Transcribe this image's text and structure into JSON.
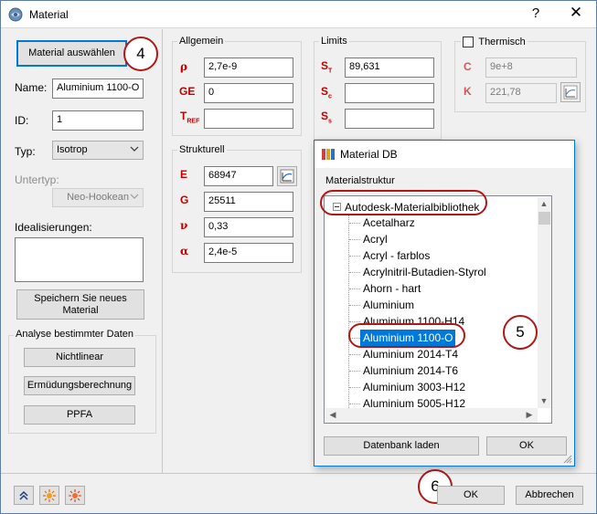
{
  "window": {
    "title": "Material",
    "help_glyph": "?",
    "close_glyph": "✕"
  },
  "left": {
    "select_material_label": "Material auswählen",
    "name_label": "Name:",
    "name_value": "Aluminium 1100-O",
    "id_label": "ID:",
    "id_value": "1",
    "type_label": "Typ:",
    "type_value": "Isotrop",
    "subtype_label": "Untertyp:",
    "subtype_value": "Neo-Hookean",
    "idealizations_label": "Idealisierungen:",
    "save_new_material_label": "Speichern Sie neues Material",
    "analysis_group_title": "Analyse bestimmter Daten",
    "nonlinear_label": "Nichtlinear",
    "fatigue_label": "Ermüdungsberechnung",
    "ppfa_label": "PPFA"
  },
  "general": {
    "title": "Allgemein",
    "rho_symbol": "ρ",
    "rho_value": "2,7e-9",
    "ge_symbol": "GE",
    "ge_value": "0",
    "tref_symbol": "T",
    "tref_sub": "REF",
    "tref_value": ""
  },
  "structural": {
    "title": "Strukturell",
    "e_symbol": "E",
    "e_value": "68947",
    "g_symbol": "G",
    "g_value": "25511",
    "nu_symbol": "ν",
    "nu_value": "0,33",
    "alpha_symbol": "α",
    "alpha_value": "2,4e-5"
  },
  "limits": {
    "title": "Limits",
    "st_symbol": "S",
    "st_sub": "T",
    "st_value": "89,631",
    "sc_symbol": "S",
    "sc_sub": "c",
    "sc_value": "",
    "ss_symbol": "S",
    "ss_sub": "s",
    "ss_value": ""
  },
  "thermal": {
    "title": "Thermisch",
    "c_symbol": "C",
    "c_value": "9e+8",
    "k_symbol": "K",
    "k_value": "221,78"
  },
  "material_db": {
    "title": "Material DB",
    "structure_label": "Materialstruktur",
    "root": "Autodesk-Materialbibliothek",
    "items": [
      "Acetalharz",
      "Acryl",
      "Acryl - farblos",
      "Acrylnitril-Butadien-Styrol",
      "Ahorn - hart",
      "Aluminium",
      "Aluminium 1100-H14",
      "Aluminium 1100-O",
      "Aluminium 2014-T4",
      "Aluminium 2014-T6",
      "Aluminium 3003-H12",
      "Aluminium 5005-H12"
    ],
    "selected": "Aluminium 1100-O",
    "load_db_label": "Datenbank laden",
    "ok_label": "OK"
  },
  "footer": {
    "ok_label": "OK",
    "cancel_label": "Abbrechen"
  },
  "callouts": {
    "c4": "4",
    "c5": "5",
    "c6": "6"
  },
  "colors": {
    "symbol_red": "#c00000",
    "selection_blue": "#0078d7",
    "callout_red": "#b01818"
  }
}
